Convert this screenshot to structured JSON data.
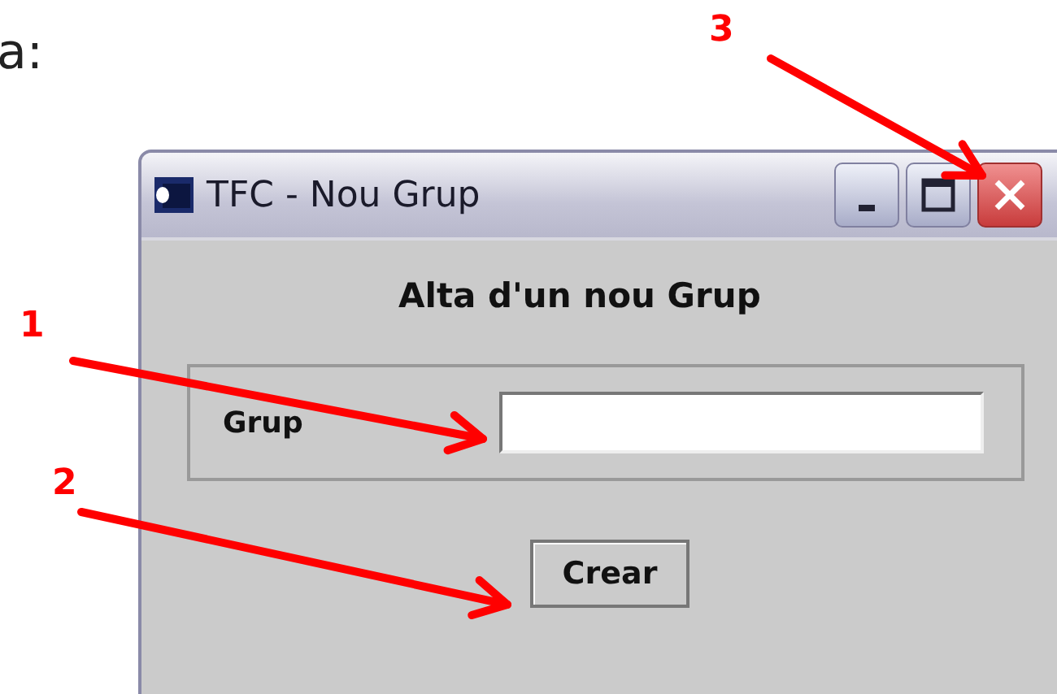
{
  "document_text": "a:",
  "window": {
    "title": "TFC - Nou Grup",
    "heading": "Alta d'un nou Grup",
    "field": {
      "label": "Grup"
    },
    "button": "Crear"
  },
  "annotations": [
    {
      "label": "1"
    },
    {
      "label": "2"
    },
    {
      "label": "3"
    }
  ]
}
